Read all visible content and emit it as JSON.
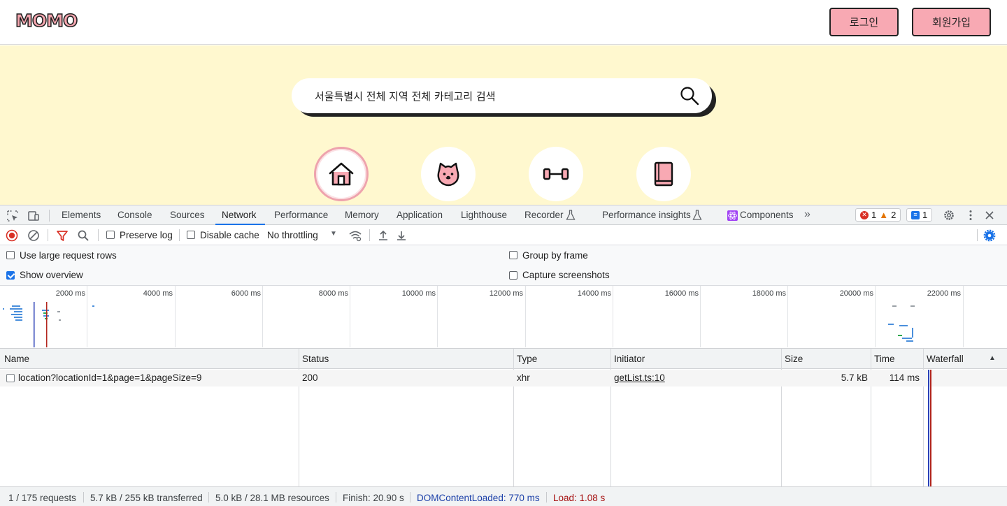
{
  "site": {
    "logo_text": "MOMO",
    "login_label": "로그인",
    "signup_label": "회원가입",
    "search_text": "서울특별시 전체 지역 전체 카테고리 검색",
    "categories": [
      {
        "icon": "house-icon",
        "active": true
      },
      {
        "icon": "dog-icon",
        "active": false
      },
      {
        "icon": "dumbbell-icon",
        "active": false
      },
      {
        "icon": "book-icon",
        "active": false
      }
    ],
    "colors": {
      "accent": "#f8a9b3",
      "hero_bg": "#fff8cf"
    }
  },
  "devtools": {
    "tabs": [
      "Elements",
      "Console",
      "Sources",
      "Network",
      "Performance",
      "Memory",
      "Application",
      "Lighthouse",
      "Recorder",
      "Performance insights",
      "Components"
    ],
    "active_tab": "Network",
    "error_count": "1",
    "warning_count": "2",
    "info_count": "1",
    "toolbar": {
      "preserve_log": "Preserve log",
      "disable_cache": "Disable cache",
      "throttling": "No throttling"
    },
    "settings": {
      "large_rows": "Use large request rows",
      "show_overview": "Show overview",
      "group_by_frame": "Group by frame",
      "capture_screenshots": "Capture screenshots"
    },
    "overview_ticks": [
      "2000 ms",
      "4000 ms",
      "6000 ms",
      "8000 ms",
      "10000 ms",
      "12000 ms",
      "14000 ms",
      "16000 ms",
      "18000 ms",
      "20000 ms",
      "22000 ms"
    ],
    "columns": {
      "name": "Name",
      "status": "Status",
      "type": "Type",
      "initiator": "Initiator",
      "size": "Size",
      "time": "Time",
      "waterfall": "Waterfall"
    },
    "rows": [
      {
        "name": "location?locationId=1&page=1&pageSize=9",
        "status": "200",
        "type": "xhr",
        "initiator": "getList.ts:10",
        "size": "5.7 kB",
        "time": "114 ms"
      }
    ],
    "status_bar": {
      "requests": "1 / 175 requests",
      "transferred": "5.7 kB / 255 kB transferred",
      "resources": "5.0 kB / 28.1 MB resources",
      "finish": "Finish: 20.90 s",
      "dom_loaded": "DOMContentLoaded: 770 ms",
      "load": "Load: 1.08 s"
    }
  }
}
